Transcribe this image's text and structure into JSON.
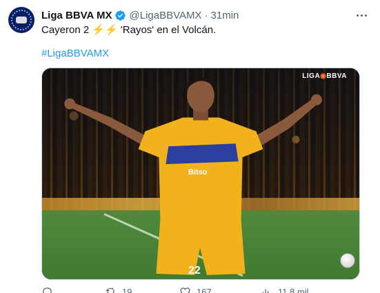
{
  "tweet": {
    "display_name": "Liga BBVA MX",
    "handle": "@LigaBBVAMX",
    "separator": "·",
    "time": "31min",
    "text_before": "Cayeron 2 ",
    "bolts": "⚡⚡",
    "text_after": " 'Rayos' en el Volcán.",
    "hashtag": "#LigaBBVAMX",
    "image_watermark": "LIGA",
    "image_watermark_brand": "BBVA",
    "jersey_sponsor": "Bitso",
    "jersey_number": "22"
  },
  "actions": {
    "reply_count": "",
    "retweet_count": "19",
    "like_count": "167",
    "views_count": "11,8 mil"
  },
  "icons": {
    "avatar": "liga-bbva-mx-logo",
    "verified": "verified-badge-icon",
    "more": "more-icon",
    "reply": "reply-icon",
    "retweet": "retweet-icon",
    "like": "like-icon",
    "views": "views-icon"
  },
  "colors": {
    "link": "#1d9bf0",
    "muted": "#536471",
    "text": "#0f1419",
    "jersey": "#f2b21b",
    "jersey_band": "#2a3fa0"
  }
}
